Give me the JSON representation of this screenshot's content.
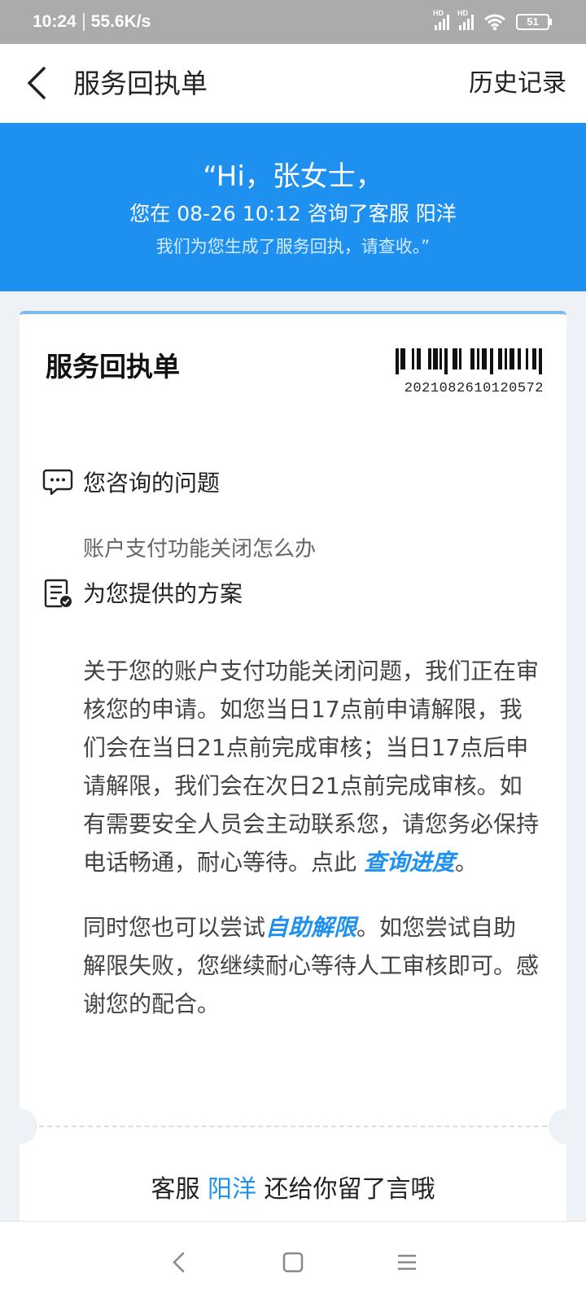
{
  "status_bar": {
    "time": "10:24",
    "speed": "55.6K/s",
    "signal_label_1": "HD",
    "signal_label_2": "HD",
    "battery": "51"
  },
  "header": {
    "title": "服务回执单",
    "history_label": "历史记录"
  },
  "hero": {
    "greeting": "“Hi，张女士，",
    "consult_line": "您在 08-26 10:12 咨询了客服 阳洋",
    "note": "我们为您生成了服务回执，请查收。”"
  },
  "receipt": {
    "title": "服务回执单",
    "number": "2021082610120572",
    "question_heading": "您咨询的问题",
    "question_text": "账户支付功能关闭怎么办",
    "solution_heading": "为您提供的方案",
    "solution_p1": "关于您的账户支付功能关闭问题，我们正在审核您的申请。如您当日17点前申请解限，我们会在当日21点前完成审核；当日17点后申请解限，我们会在次日21点前完成审核。如有需要安全人员会主动联系您，请您务必保持电话畅通，耐心等待。点此",
    "link_progress": "查询进度",
    "p1_end": "。",
    "p2_start": "同时您也可以尝试",
    "link_unlock": "自助解限",
    "p2_end": "。如您尝试自助解限失败，您继续耐心等待人工审核即可。感谢您的配合。",
    "footer_prefix": "客服 ",
    "footer_agent": "阳洋",
    "footer_suffix": " 还给你留了言哦"
  },
  "icons": {
    "back": "back-arrow-icon",
    "question": "chat-bubble-icon",
    "solution": "checklist-icon"
  },
  "colors": {
    "accent": "#1e90f0",
    "hero_bg": "#1e90f0",
    "status_bar_bg": "#ababab"
  }
}
